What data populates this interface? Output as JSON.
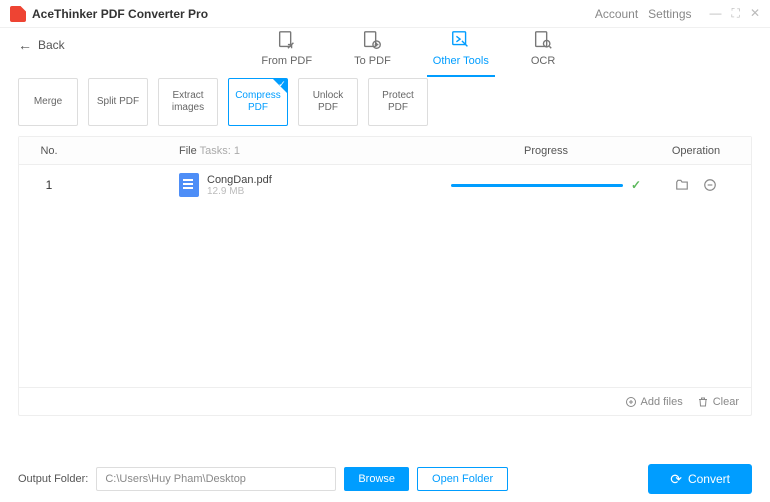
{
  "app": {
    "title": "AceThinker PDF Converter Pro",
    "account": "Account",
    "settings": "Settings"
  },
  "nav": {
    "back": "Back"
  },
  "tabs": {
    "from_pdf": "From PDF",
    "to_pdf": "To PDF",
    "other_tools": "Other Tools",
    "ocr": "OCR"
  },
  "tools": {
    "merge": "Merge",
    "split": "Split PDF",
    "extract": "Extract images",
    "compress": "Compress PDF",
    "unlock": "Unlock PDF",
    "protect": "Protect PDF"
  },
  "table": {
    "head_no": "No.",
    "head_file": "File",
    "tasks_label": "Tasks:",
    "tasks_count": "1",
    "head_progress": "Progress",
    "head_operation": "Operation"
  },
  "rows": [
    {
      "no": "1",
      "name": "CongDan.pdf",
      "size": "12.9 MB"
    }
  ],
  "footer": {
    "add": "Add files",
    "clear": "Clear"
  },
  "bottom": {
    "label": "Output Folder:",
    "path": "C:\\Users\\Huy Pham\\Desktop",
    "browse": "Browse",
    "open": "Open Folder",
    "convert": "Convert"
  }
}
